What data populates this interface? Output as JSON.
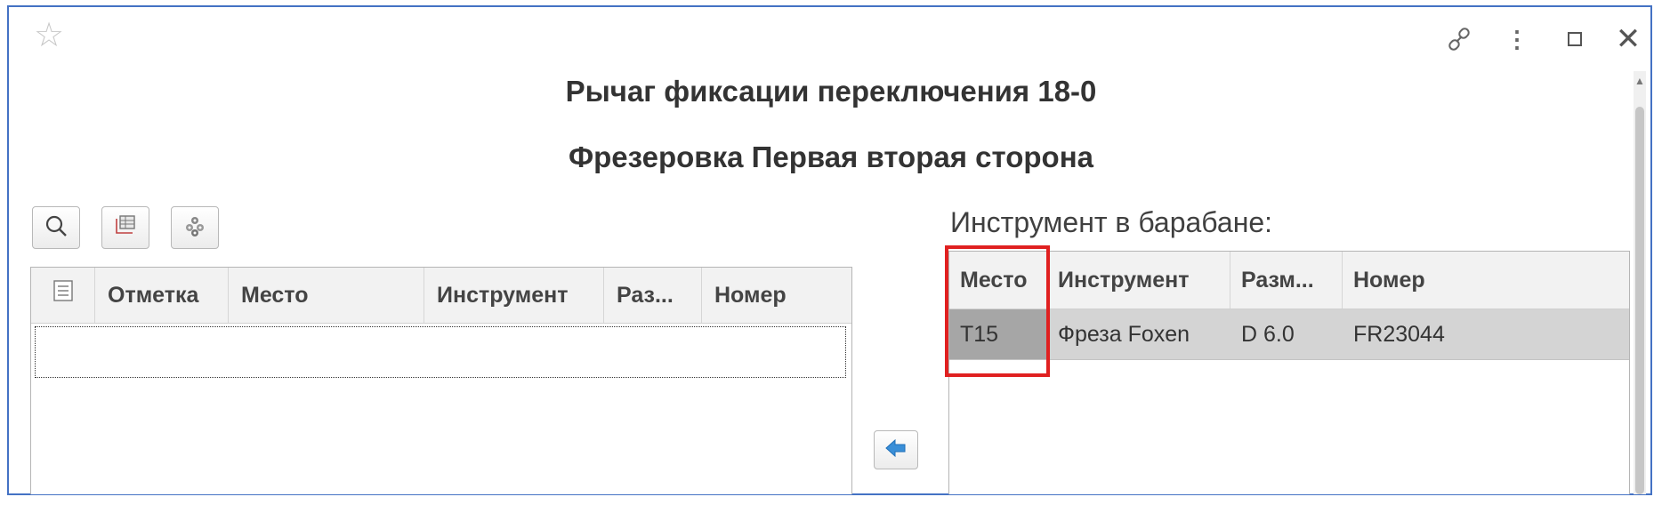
{
  "header": {
    "favorite_icon": "star-icon",
    "link_icon": "link-icon",
    "more_icon": "more-vertical-icon",
    "maximize_icon": "maximize-icon",
    "close_icon": "close-icon",
    "title": "Рычаг фиксации переключения 18-0",
    "subtitle": "Фрезеровка Первая вторая сторона"
  },
  "toolbar": {
    "buttons": [
      "search-icon",
      "output-list-icon",
      "settings-group-icon"
    ]
  },
  "left_table": {
    "columns": [
      "Отметка",
      "Место",
      "Инструмент",
      "Раз...",
      "Номер"
    ],
    "rows": []
  },
  "transfer_button": {
    "icon": "arrow-left-icon",
    "accent": "#3a8fd8"
  },
  "right_table": {
    "caption": "Инструмент в барабане:",
    "columns": [
      "Место",
      "Инструмент",
      "Разм...",
      "Номер"
    ],
    "rows": [
      {
        "place": "T15",
        "tool": "Фреза Foxen",
        "size": "D 6.0",
        "number": "FR23044"
      }
    ]
  },
  "colors": {
    "frame_border": "#4472c4",
    "highlight_border": "#e02020",
    "selected_row": "#d4d4d4",
    "selected_cell": "#a6a6a6"
  }
}
